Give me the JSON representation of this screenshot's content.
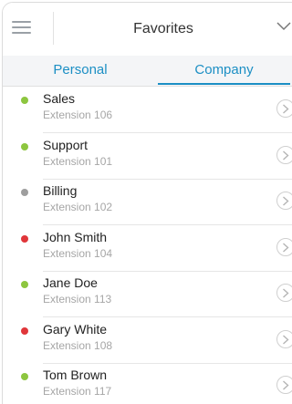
{
  "header": {
    "title": "Favorites",
    "menu_icon": "hamburger-menu-icon",
    "dropdown_icon": "chevron-down-icon"
  },
  "tabs": [
    {
      "label": "Personal",
      "active": false
    },
    {
      "label": "Company",
      "active": true
    }
  ],
  "colors": {
    "accent": "#1c8fc4",
    "available": "#8dc63f",
    "offline": "#9e9e9e",
    "busy": "#e0363a"
  },
  "contacts": [
    {
      "name": "Sales",
      "extension": "Extension 106",
      "status": "available"
    },
    {
      "name": "Support",
      "extension": "Extension 101",
      "status": "available"
    },
    {
      "name": "Billing",
      "extension": "Extension 102",
      "status": "offline"
    },
    {
      "name": "John Smith",
      "extension": "Extension 104",
      "status": "busy"
    },
    {
      "name": "Jane Doe",
      "extension": "Extension 113",
      "status": "available"
    },
    {
      "name": "Gary White",
      "extension": "Extension 108",
      "status": "busy"
    },
    {
      "name": "Tom Brown",
      "extension": "Extension 117",
      "status": "available"
    }
  ]
}
